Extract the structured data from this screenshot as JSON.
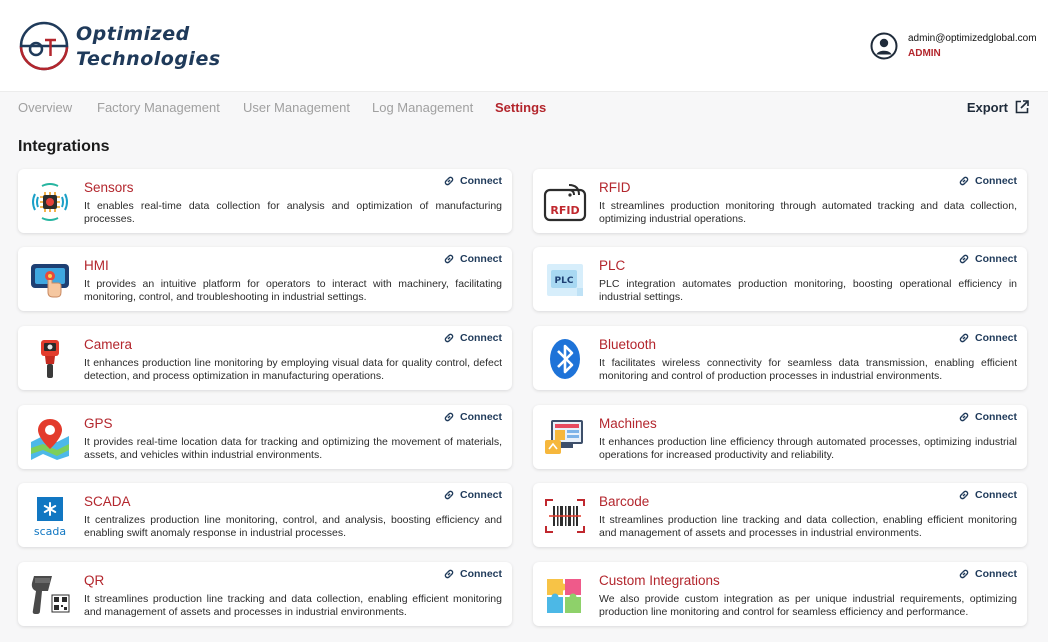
{
  "brand": {
    "line1": "Optimized",
    "line2": "Technologies",
    "accent": "#b3262d",
    "navy": "#1f3a5a"
  },
  "user": {
    "email": "admin@optimizedglobal.com",
    "role": "ADMIN"
  },
  "nav": {
    "tabs": [
      "Overview",
      "Factory Management",
      "User Management",
      "Log Management",
      "Settings"
    ],
    "active": "Settings",
    "export_label": "Export"
  },
  "section_title": "Integrations",
  "connect_label": "Connect",
  "integrations": [
    {
      "name": "Sensors",
      "icon": "sensor-chip-icon",
      "desc": "It enables real-time data collection for analysis and optimization of manufacturing processes."
    },
    {
      "name": "RFID",
      "icon": "rfid-icon",
      "desc": "It streamlines production monitoring through automated tracking and data collection, optimizing industrial operations."
    },
    {
      "name": "HMI",
      "icon": "hmi-touchscreen-icon",
      "desc": "It provides an intuitive platform for operators to interact with machinery, facilitating monitoring, control, and troubleshooting in industrial settings."
    },
    {
      "name": "PLC",
      "icon": "plc-icon",
      "desc": "PLC integration automates production monitoring, boosting operational efficiency in industrial settings."
    },
    {
      "name": "Camera",
      "icon": "handheld-camera-icon",
      "desc": "It enhances production line monitoring by employing visual data for quality control, defect detection, and process optimization in manufacturing operations."
    },
    {
      "name": "Bluetooth",
      "icon": "bluetooth-icon",
      "desc": "It facilitates wireless connectivity for seamless data transmission, enabling efficient monitoring and control of production processes in industrial environments."
    },
    {
      "name": "GPS",
      "icon": "map-pin-icon",
      "desc": "It provides real-time location data for tracking and optimizing the movement of materials, assets, and vehicles within industrial environments."
    },
    {
      "name": "Machines",
      "icon": "machine-dashboard-icon",
      "desc": "It enhances production line efficiency through automated processes, optimizing industrial operations for increased productivity and reliability."
    },
    {
      "name": "SCADA",
      "icon": "scada-icon",
      "desc": "It centralizes production line monitoring, control, and analysis, boosting efficiency and enabling swift anomaly response in industrial processes."
    },
    {
      "name": "Barcode",
      "icon": "barcode-icon",
      "desc": "It streamlines production line tracking and data collection, enabling efficient monitoring and management of assets and processes in industrial environments."
    },
    {
      "name": "QR",
      "icon": "qr-scanner-icon",
      "desc": "It streamlines production line tracking and data collection, enabling efficient monitoring and management of assets and processes in industrial environments."
    },
    {
      "name": "Custom Integrations",
      "icon": "puzzle-icon",
      "desc": "We also provide custom integration as per unique industrial requirements, optimizing production line monitoring and control for seamless efficiency and performance."
    }
  ]
}
